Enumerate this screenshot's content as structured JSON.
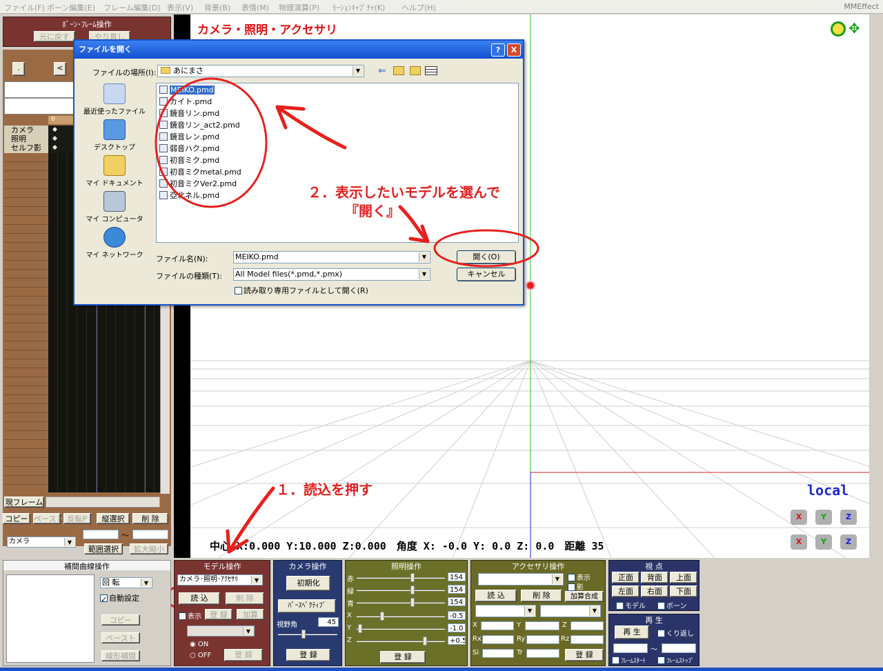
{
  "menu": {
    "items": [
      "ファイル(F)",
      "ボーン編集(E)",
      "フレーム編集(D)",
      "表示(V)",
      "背景(B)",
      "表情(M)",
      "物理演算(P)",
      "ﾓｰｼｮﾝｷｬﾌﾟﾁｬ(K)",
      "ヘルプ(H)"
    ],
    "app_name": "MMEffect"
  },
  "bone_panel": {
    "title": "ﾎﾞｰﾝ･ﾌﾚｰﾑ操作",
    "undo": "元に戻す",
    "redo": "やり直し"
  },
  "timeline": {
    "frame0": "0",
    "tracks": [
      "カメラ",
      "照明",
      "セルフ影"
    ],
    "current_frame_label": "現フレーム",
    "prev": "<",
    "copy": "コピー",
    "paste": "ペースト",
    "reverse_paste": "反転P",
    "vselect": "縦選択",
    "delete": "削 除",
    "target": "カメラ",
    "tilde": "～",
    "range_select": "範囲選択",
    "zoom": "拡大縮小"
  },
  "viewport": {
    "title": "カメラ・照明・アクセサリ",
    "status": "中心 X:0.000 Y:10.000 Z:0.000　角度 X: -0.0 Y: 0.0 Z: 0.0　距離 35",
    "local": "local"
  },
  "dialog": {
    "title": "ファイルを開く",
    "location_label": "ファイルの場所(I):",
    "location_value": "あにまさ",
    "places": [
      "最近使ったファイル",
      "デスクトップ",
      "マイ ドキュメント",
      "マイ コンピュータ",
      "マイ ネットワーク"
    ],
    "files": [
      "MEIKO.pmd",
      "カイト.pmd",
      "鏡音リン.pmd",
      "鏡音リン_act2.pmd",
      "鏡音レン.pmd",
      "弱音ハク.pmd",
      "初音ミク.pmd",
      "初音ミクmetal.pmd",
      "初音ミクVer2.pmd",
      "亞北ネル.pmd"
    ],
    "filename_label": "ファイル名(N):",
    "filename_value": "MEIKO.pmd",
    "filetype_label": "ファイルの種類(T):",
    "filetype_value": "All Model files(*.pmd,*.pmx)",
    "readonly_label": "読み取り専用ファイルとして開く(R)",
    "open": "開く(O)",
    "cancel": "キャンセル",
    "help": "?",
    "close": "X"
  },
  "annotations": {
    "step1": "１．読込を押す",
    "step2a": "２．表示したいモデルを選んで",
    "step2b": "『開く』"
  },
  "interp_panel": {
    "title": "補間曲線操作",
    "rotation": "回 転",
    "auto": "自動設定",
    "copy": "コピー",
    "paste": "ペースト",
    "linear": "線形補間"
  },
  "model_panel": {
    "title": "モデル操作",
    "model_select": "カメラ･照明･ｱｸｾｻﾘ",
    "load": "読 込",
    "delete": "削 除",
    "display": "表示",
    "register": "登 録",
    "add": "加算",
    "on": "ON",
    "off": "OFF"
  },
  "camera_panel": {
    "title": "カメラ操作",
    "init": "初期化",
    "perspective": "ﾊﾟｰｽﾍﾟｸﾃｨﾌﾞ",
    "fov_label": "視野角",
    "fov": "45",
    "register": "登 録"
  },
  "light_panel": {
    "title": "照明操作",
    "r": "赤",
    "g": "緑",
    "b": "青",
    "rv": "154",
    "gv": "154",
    "bv": "154",
    "x": "X",
    "y": "Y",
    "z": "Z",
    "xv": "-0.5",
    "yv": "-1.0",
    "zv": "+0.5",
    "register": "登 録"
  },
  "acc_panel": {
    "title": "アクセサリ操作",
    "show": "表示",
    "shadow": "影",
    "load": "読 込",
    "delete": "削 除",
    "add_blend": "加算合成",
    "x": "X",
    "y": "Y",
    "z": "Z",
    "rx": "Rx",
    "ry": "Ry",
    "rz": "Rz",
    "si": "Si",
    "tr": "Tr",
    "register": "登 録"
  },
  "view_panel": {
    "title": "視 点",
    "front": "正面",
    "back": "背面",
    "top": "上面",
    "left": "左面",
    "right": "右面",
    "bottom": "下面",
    "model": "モデル",
    "bone": "ボーン"
  },
  "play_panel": {
    "title": "再 生",
    "play": "再 生",
    "loop": "くり返し",
    "tilde": "～",
    "frame_start": "ﾌﾚｰﾑｽﾀｰﾄ",
    "frame_stop": "ﾌﾚｰﾑｽﾄｯﾌﾟ"
  }
}
